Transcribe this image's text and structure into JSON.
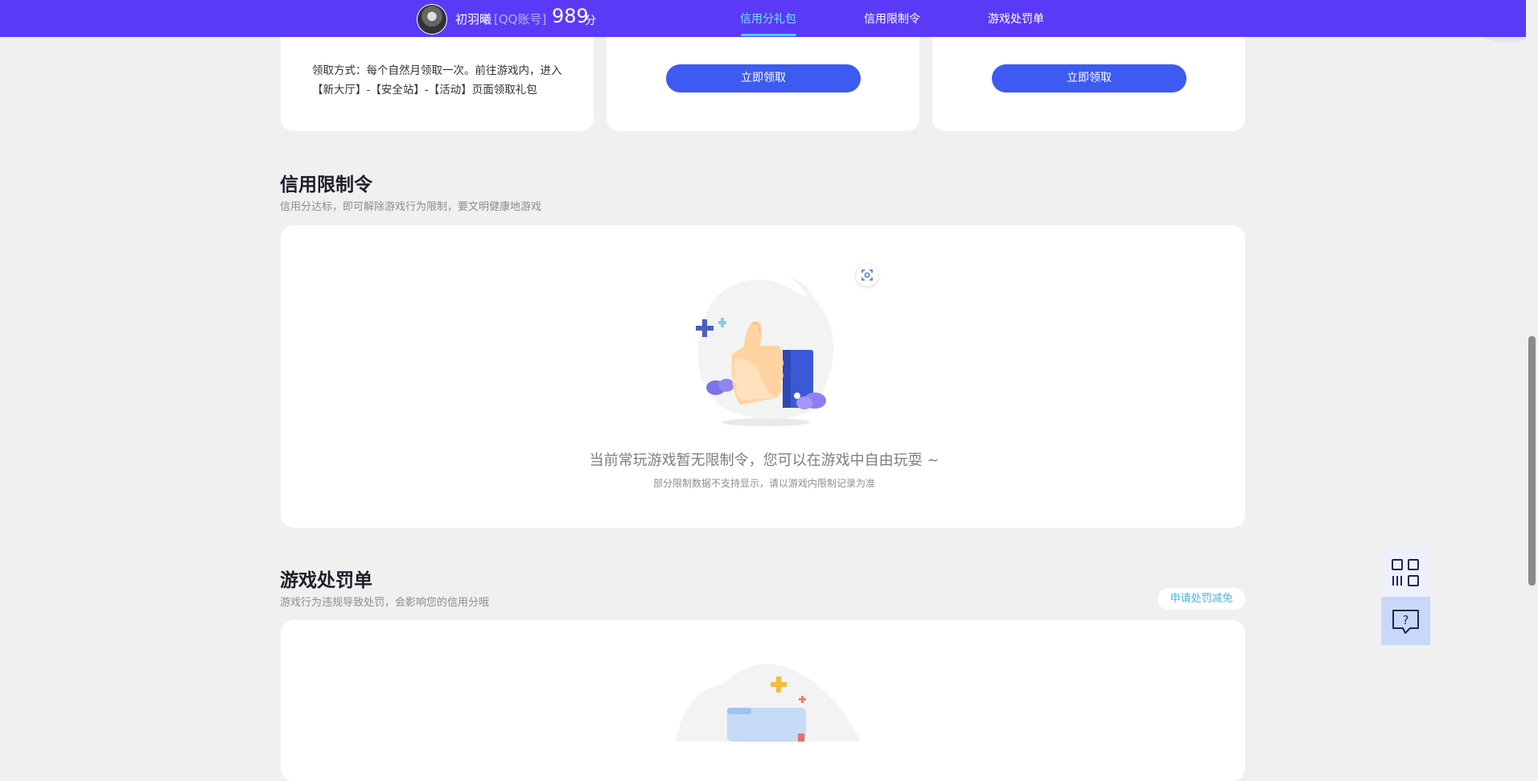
{
  "topbar": {
    "username": "初羽曦",
    "account_type": "[QQ账号]",
    "score": "989",
    "score_unit": "分",
    "nav": [
      {
        "label": "信用分礼包",
        "active": true
      },
      {
        "label": "信用限制令",
        "active": false
      },
      {
        "label": "游戏处罚单",
        "active": false
      }
    ]
  },
  "gift_cards": {
    "card1_text": "领取方式：每个自然月领取一次。前往游戏内，进入【新大厅】-【安全站】-【活动】页面领取礼包",
    "card2_button": "立即领取",
    "card3_button": "立即领取"
  },
  "restriction": {
    "title": "信用限制令",
    "subtitle": "信用分达标，即可解除游戏行为限制，要文明健康地游戏",
    "empty_title": "当前常玩游戏暂无限制令，您可以在游戏中自由玩耍 ~",
    "empty_sub": "部分限制数据不支持显示，请以游戏内限制记录为准"
  },
  "penalty": {
    "title": "游戏处罚单",
    "subtitle": "游戏行为违规导致处罚，会影响您的信用分哦",
    "apply_button": "申请处罚减免"
  },
  "colors": {
    "topbar": "#5b3af7",
    "button": "#3d5af1",
    "nav_active": "#6fe6ff"
  },
  "icons": {
    "side_top": "qr-code-icon",
    "side_bottom": "help-chat-icon",
    "scan": "scan-icon"
  }
}
